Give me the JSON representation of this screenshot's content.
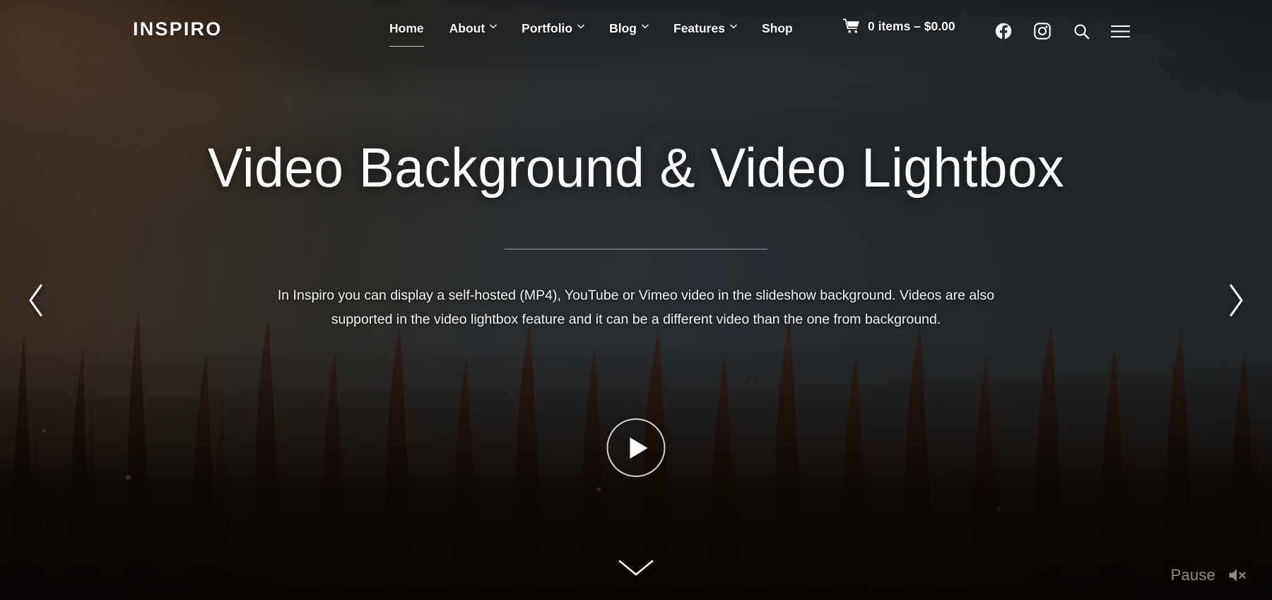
{
  "site": {
    "logo": "INSPIRO"
  },
  "nav": {
    "items": [
      {
        "label": "Home",
        "has_dropdown": false,
        "active": true
      },
      {
        "label": "About",
        "has_dropdown": true,
        "active": false
      },
      {
        "label": "Portfolio",
        "has_dropdown": true,
        "active": false
      },
      {
        "label": "Blog",
        "has_dropdown": true,
        "active": false
      },
      {
        "label": "Features",
        "has_dropdown": true,
        "active": false
      },
      {
        "label": "Shop",
        "has_dropdown": false,
        "active": false
      }
    ]
  },
  "cart": {
    "icon": "shopping-cart-icon",
    "text": "0 items – $0.00",
    "count": 0,
    "total": "$0.00"
  },
  "social": {
    "facebook": "facebook-icon",
    "instagram": "instagram-icon",
    "search": "search-icon",
    "menu": "hamburger-menu-icon"
  },
  "hero": {
    "title": "Video Background & Video Lightbox",
    "body": "In Inspiro you can display a self-hosted (MP4), YouTube or Vimeo video in the slideshow background. Videos are also supported in the video lightbox feature and it can be a different video than the one from background.",
    "play_icon": "play-icon"
  },
  "slider": {
    "prev_icon": "chevron-left-icon",
    "next_icon": "chevron-right-icon",
    "scroll_icon": "chevron-down-icon"
  },
  "media_controls": {
    "pause_label": "Pause",
    "mute_icon": "speaker-muted-icon"
  },
  "colors": {
    "text_primary": "#ffffff",
    "text_body": "#f2f2f2",
    "control_muted": "#8e8a86",
    "bg_warm": "#4a3a30",
    "bg_cool": "#2c3237",
    "bg_ground": "#0d0805"
  }
}
